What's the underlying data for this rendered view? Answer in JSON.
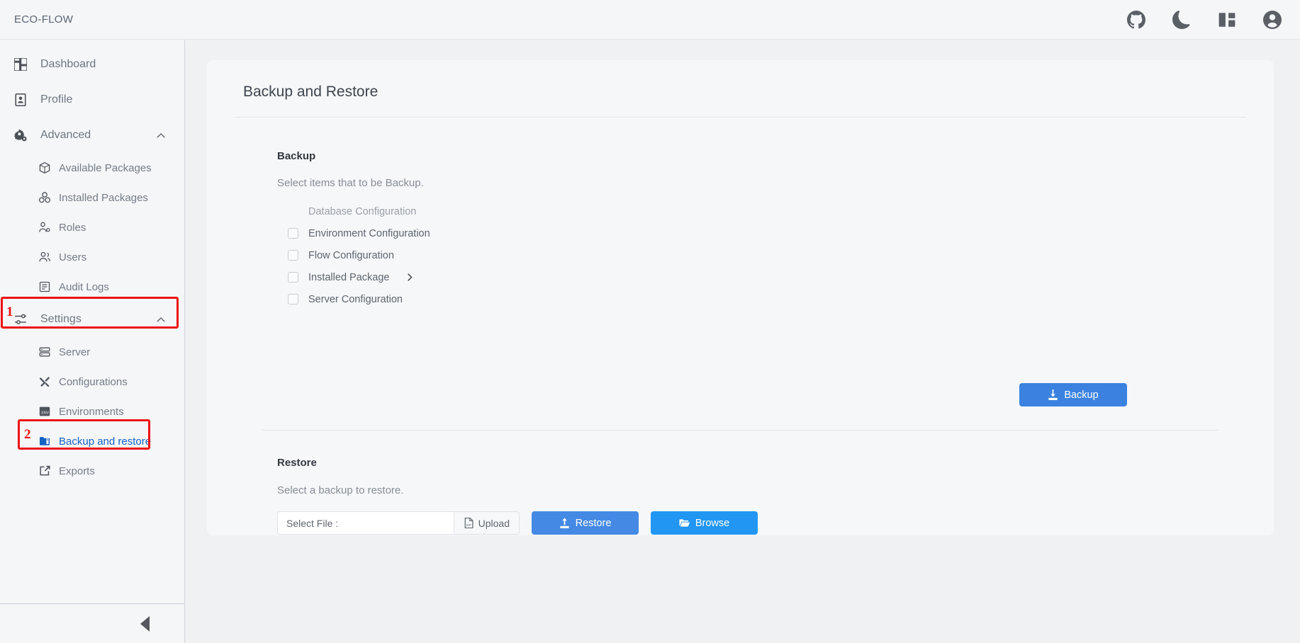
{
  "topbar": {
    "brand": "ECO-FLOW",
    "icons": [
      {
        "name": "github-icon",
        "label": "GitHub"
      },
      {
        "name": "dark-mode-icon",
        "label": "Dark mode"
      },
      {
        "name": "layout-panel-icon",
        "label": "Layout"
      },
      {
        "name": "user-account-icon",
        "label": "Account"
      }
    ]
  },
  "sidebar": {
    "items": [
      {
        "label": "Dashboard",
        "icon": "dashboard-icon"
      },
      {
        "label": "Profile",
        "icon": "profile-icon"
      },
      {
        "label": "Advanced",
        "icon": "advanced-gear-icon",
        "expanded": true
      }
    ],
    "advanced_children": [
      {
        "label": "Available Packages",
        "icon": "package-available-icon"
      },
      {
        "label": "Installed Packages",
        "icon": "package-installed-icon"
      },
      {
        "label": "Roles",
        "icon": "roles-icon"
      },
      {
        "label": "Users",
        "icon": "users-icon"
      },
      {
        "label": "Audit Logs",
        "icon": "audit-logs-icon"
      }
    ],
    "settings": {
      "label": "Settings",
      "icon": "settings-sliders-icon",
      "expanded": true
    },
    "settings_children": [
      {
        "label": "Server",
        "icon": "server-icon",
        "active": false
      },
      {
        "label": "Configurations",
        "icon": "configurations-tools-icon",
        "active": false
      },
      {
        "label": "Environments",
        "icon": "environments-env-icon",
        "active": false
      },
      {
        "label": "Backup and restore",
        "icon": "backup-restore-folder-icon",
        "active": true
      },
      {
        "label": "Exports",
        "icon": "exports-icon",
        "active": false
      }
    ],
    "collapse_label": "Collapse sidebar"
  },
  "annotations": [
    {
      "number": "1",
      "target": "Settings"
    },
    {
      "number": "2",
      "target": "Backup and restore"
    }
  ],
  "page": {
    "title": "Backup and Restore"
  },
  "backup": {
    "heading": "Backup",
    "description": "Select items that to be Backup.",
    "items": [
      {
        "label": "Database Configuration",
        "checked": false,
        "disabled": true,
        "expandable": false
      },
      {
        "label": "Environment Configuration",
        "checked": false,
        "disabled": false,
        "expandable": false
      },
      {
        "label": "Flow Configuration",
        "checked": false,
        "disabled": false,
        "expandable": false
      },
      {
        "label": "Installed Package",
        "checked": false,
        "disabled": false,
        "expandable": true
      },
      {
        "label": "Server Configuration",
        "checked": false,
        "disabled": false,
        "expandable": false
      }
    ],
    "button_label": "Backup"
  },
  "restore": {
    "heading": "Restore",
    "description": "Select a backup to restore.",
    "file_placeholder": "Select File :",
    "file_value": "",
    "upload_label": "Upload",
    "restore_label": "Restore",
    "browse_label": "Browse"
  },
  "colors": {
    "accent_blue": "#3b82e0",
    "browse_blue": "#2196f3",
    "active_link": "#1261c4",
    "annotation_red": "#ee1111",
    "page_bg": "#f0f1f3",
    "card_bg": "#f6f7f9",
    "sidebar_bg": "#f5f6f8"
  }
}
